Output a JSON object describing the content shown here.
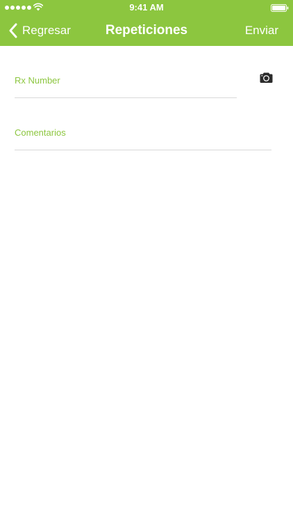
{
  "status_bar": {
    "time": "9:41 AM",
    "signal_icon": "signal-dots-icon",
    "wifi_icon": "wifi-icon",
    "battery_icon": "battery-icon"
  },
  "nav": {
    "back_label": "Regresar",
    "back_icon": "chevron-left-icon",
    "title": "Repeticiones",
    "send_label": "Enviar"
  },
  "form": {
    "rx_number_label": "Rx Number",
    "rx_number_value": "",
    "camera_icon": "camera-icon",
    "comments_label": "Comentarios",
    "comments_value": ""
  },
  "colors": {
    "accent": "#8cc63f",
    "divider": "#d9d9d9",
    "background": "#ffffff"
  }
}
